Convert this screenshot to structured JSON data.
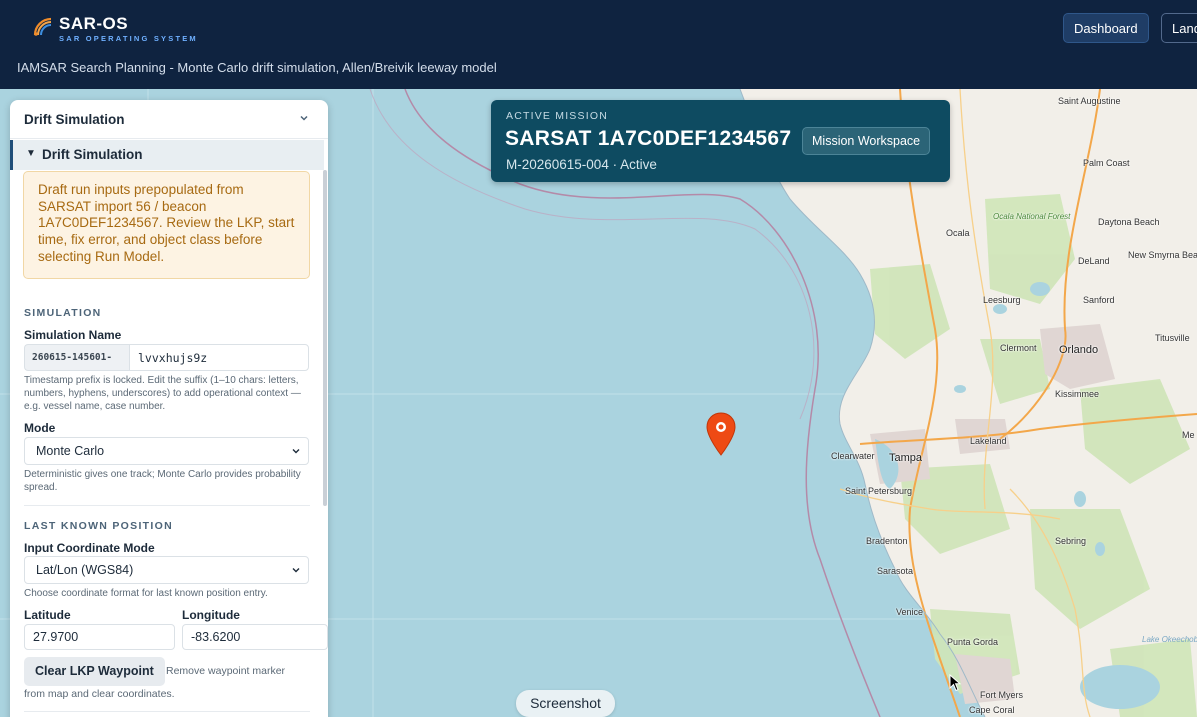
{
  "app": {
    "brand": "SAR-OS",
    "brand_sub": "SAR OPERATING SYSTEM",
    "subtitle": "IAMSAR Search Planning - Monte Carlo drift simulation, Allen/Breivik leeway model",
    "nav": {
      "dashboard": "Dashboard",
      "land": "Land"
    },
    "icon": "radar-signal-icon"
  },
  "mission": {
    "kicker": "ACTIVE MISSION",
    "title": "SARSAT 1A7C0DEF1234567",
    "meta": "M-20260615-004 · Active",
    "workspace_button": "Mission Workspace"
  },
  "panel": {
    "title": "Drift Simulation",
    "section_title": "Drift Simulation",
    "notice": "Draft run inputs prepopulated from SARSAT import 56 / beacon 1A7C0DEF1234567. Review the LKP, start time, fix error, and object class before selecting Run Model.",
    "simulation_heading": "SIMULATION",
    "sim_name_label": "Simulation Name",
    "sim_name_prefix": "260615-145601-",
    "sim_name_suffix": "lvvxhujs9z",
    "sim_name_help": "Timestamp prefix is locked. Edit the suffix (1–10 chars: letters, numbers, hyphens, underscores) to add operational context — e.g. vessel name, case number.",
    "mode_label": "Mode",
    "mode_value": "Monte Carlo",
    "mode_help": "Deterministic gives one track; Monte Carlo provides probability spread.",
    "lkp_heading": "LAST KNOWN POSITION",
    "coord_mode_label": "Input Coordinate Mode",
    "coord_mode_value": "Lat/Lon (WGS84)",
    "coord_mode_help": "Choose coordinate format for last known position entry.",
    "lat_label": "Latitude",
    "lat_value": "27.9700",
    "lon_label": "Longitude",
    "lon_value": "-83.6200",
    "clear_button": "Clear LKP Waypoint",
    "clear_help_1": "Remove waypoint marker",
    "clear_help_2": "from map and clear coordinates."
  },
  "map": {
    "places": [
      "Saint Augustine",
      "Palm Coast",
      "Ocala National Forest",
      "Ocala",
      "Daytona Beach",
      "DeLand",
      "New Smyrna Beach",
      "Leesburg",
      "Sanford",
      "Titusville",
      "Clermont",
      "Orlando",
      "Kissimmee",
      "Lakeland",
      "Me",
      "Clearwater",
      "Tampa",
      "Saint Petersburg",
      "Bradenton",
      "Sebring",
      "Sarasota",
      "Venice",
      "Punta Gorda",
      "Lake Okeechobee",
      "Fort Myers",
      "Cape Coral"
    ]
  },
  "screenshot_button": "Screenshot"
}
